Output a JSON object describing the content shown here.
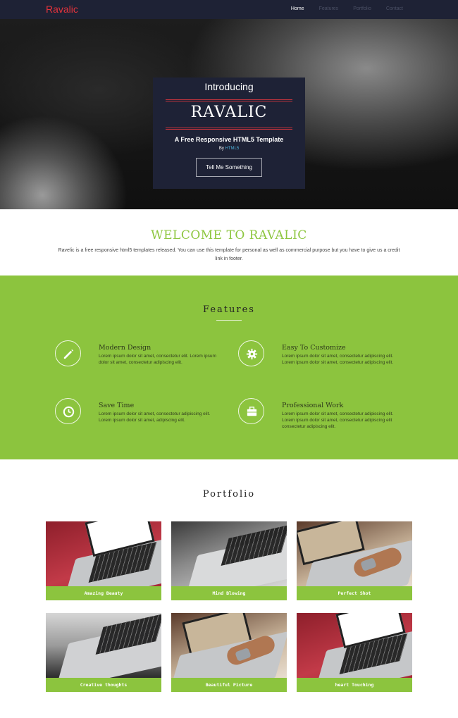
{
  "nav": {
    "logo": "Ravalic",
    "links": [
      "Home",
      "Features",
      "Portfolio",
      "Contact"
    ]
  },
  "hero": {
    "intro": "Introducing",
    "brand": "RAVALIC",
    "subtitle": "A Free Responsive HTML5 Template",
    "by_prefix": "By",
    "by_link": "HTML5",
    "button": "Tell Me Something"
  },
  "welcome": {
    "title": "WELCOME TO RAVALIC",
    "text": "Ravelic is a free responsive html5 templates released. You can use this template for personal as well as commercial purpose but you have to give us a credit link in footer."
  },
  "features": {
    "title": "Features",
    "items": [
      {
        "icon": "pencil-icon",
        "title": "Modern Design",
        "text": "Lorem ipsum dolor sit amet, consectetur elit. Lorem ipsum dolor sit amet, consectetur adipiscing elit."
      },
      {
        "icon": "gear-icon",
        "title": "Easy To Customize",
        "text": "Lorem ipsum dolor sit amet, consectetur adipiscing elit. Lorem ipsum dolor sit amet, consectetur adipiscing elit."
      },
      {
        "icon": "clock-icon",
        "title": "Save Time",
        "text": "Lorem ipsum dolor sit amet, consectetur adipiscing elit. Lorem ipsum dolor sit amet, adipiscing elit."
      },
      {
        "icon": "briefcase-icon",
        "title": "Professional Work",
        "text": "Lorem ipsum dolor sit amet, consectetur adipiscing elit. Lorem ipsum dolor sit amet, consectetur adipiscing elit consectetur adipiscing elit."
      }
    ]
  },
  "portfolio": {
    "title": "Portfolio",
    "items": [
      {
        "caption": "Amazing Beauty"
      },
      {
        "caption": "Mind Blowing"
      },
      {
        "caption": "Perfect Shot"
      },
      {
        "caption": "Creative thoughts"
      },
      {
        "caption": "Beautiful Picture"
      },
      {
        "caption": "heart Touching"
      }
    ]
  },
  "colors": {
    "accent": "#8cc43e",
    "nav_bg": "#1e2235",
    "logo": "#e2333c"
  }
}
